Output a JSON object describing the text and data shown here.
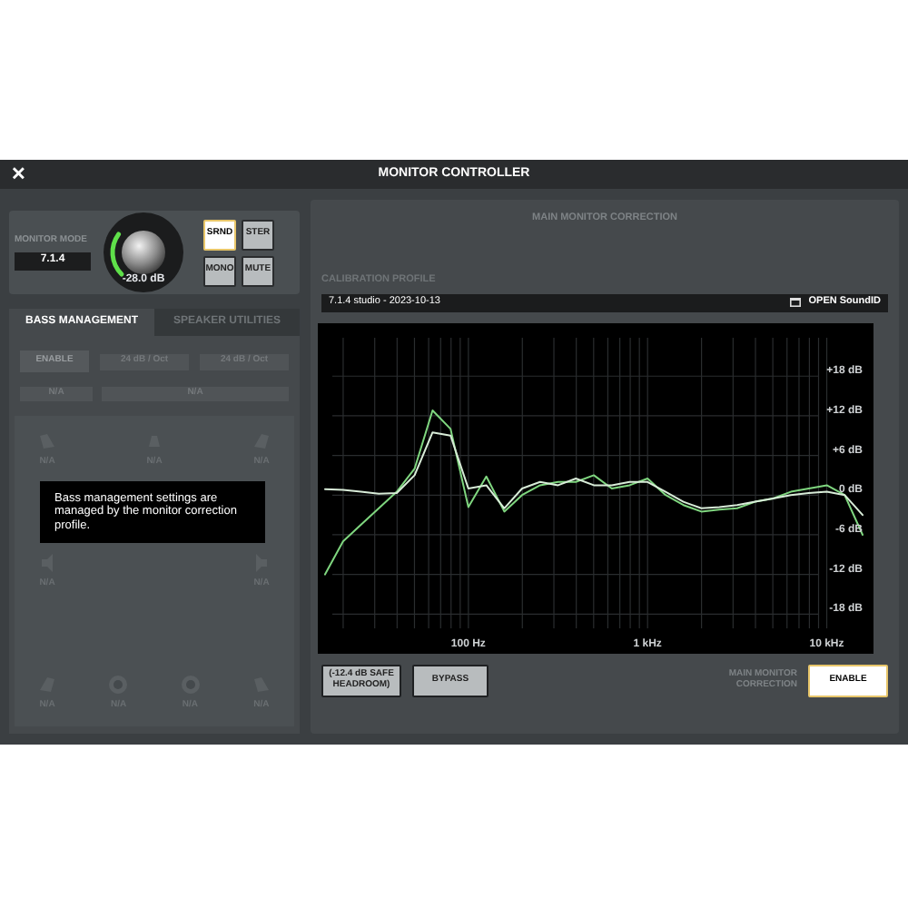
{
  "window": {
    "title": "MONITOR CONTROLLER",
    "close": "✕"
  },
  "monitor": {
    "mode_label": "MONITOR MODE",
    "mode_value": "7.1.4",
    "knob": {
      "level": 0.3,
      "reading": "-28.0 dB"
    },
    "buttons": [
      {
        "label": "SRND",
        "selected": true
      },
      {
        "label": "STER",
        "selected": false
      },
      {
        "label": "MONO",
        "selected": false
      },
      {
        "label": "MUTE",
        "selected": false
      }
    ]
  },
  "tabs": [
    {
      "label": "BASS MANAGEMENT",
      "selected": true
    },
    {
      "label": "SPEAKER UTILITIES",
      "selected": false
    }
  ],
  "bass": {
    "enable": "ENABLE",
    "filters": [
      "24 dB / Oct",
      "24 dB / Oct"
    ],
    "selectors": [
      "N/A",
      "N/A"
    ],
    "speaker_rows": [
      [
        {
          "kind": "angled-left",
          "label": "N/A"
        },
        {
          "kind": "center",
          "label": "N/A"
        },
        {
          "kind": "angled-right",
          "label": "N/A"
        }
      ],
      [
        {
          "kind": "side-left",
          "label": "N/A"
        },
        {
          "kind": "side-right",
          "label": "N/A"
        }
      ],
      [
        {
          "kind": "rear-left",
          "label": "N/A"
        },
        {
          "kind": "sub",
          "label": "N/A"
        },
        {
          "kind": "sub",
          "label": "N/A"
        },
        {
          "kind": "rear-right",
          "label": "N/A"
        }
      ]
    ],
    "tooltip": "Bass management settings are managed by the monitor correction profile."
  },
  "correction": {
    "title": "MAIN MONITOR CORRECTION",
    "profile_label": "CALIBRATION PROFILE",
    "profile": "7.1.4 studio - 2023-10-13",
    "open": "OPEN SoundID",
    "chart_data": {
      "type": "line",
      "categories": [
        null,
        null,
        null,
        null,
        null,
        null,
        null,
        null,
        "100 Hz",
        null,
        null,
        null,
        null,
        null,
        null,
        null,
        null,
        null,
        "1 kHz",
        null,
        null,
        null,
        null,
        null,
        null,
        null,
        null,
        null,
        "10 kHz",
        null,
        null
      ],
      "series": [
        {
          "color": "#7fd67f",
          "values": [
            -12,
            -7,
            -4.5,
            -2,
            0.5,
            4,
            12.8,
            10,
            -1.8,
            2.8,
            -2.5,
            0,
            1.5,
            2,
            2,
            3,
            1,
            1.5,
            2.5,
            0,
            -1.5,
            -2.5,
            -2.2,
            -2,
            -1,
            -0.5,
            0.5,
            1,
            1.5,
            0,
            -6
          ]
        },
        {
          "color": "#d8ecd8",
          "values": [
            0.9,
            0.8,
            0.5,
            0.2,
            0.3,
            3,
            9.5,
            9,
            1,
            1.5,
            -2,
            1,
            2,
            1.5,
            2.5,
            1.5,
            1.5,
            2,
            2,
            0.5,
            -1,
            -2,
            -1.8,
            -1.5,
            -1,
            -0.5,
            0,
            0.3,
            0.5,
            0,
            -3
          ]
        }
      ],
      "ylim": [
        -24,
        26
      ],
      "grid": true,
      "yticks": [
        {
          "value": 18,
          "label": "+18 dB"
        },
        {
          "value": 12,
          "label": "+12 dB"
        },
        {
          "value": 6,
          "label": "+6 dB"
        },
        {
          "value": 0,
          "label": "0 dB"
        },
        {
          "value": -6,
          "label": "-6 dB"
        },
        {
          "value": -12,
          "label": "-12 dB"
        },
        {
          "value": -18,
          "label": "-18 dB"
        }
      ]
    },
    "headroom": "(-12.4 dB SAFE HEADROOM)",
    "bypass": {
      "label": "BYPASS",
      "on": false
    },
    "enable_label": "MAIN MONITOR CORRECTION",
    "enable": {
      "label": "ENABLE",
      "on": true
    }
  }
}
